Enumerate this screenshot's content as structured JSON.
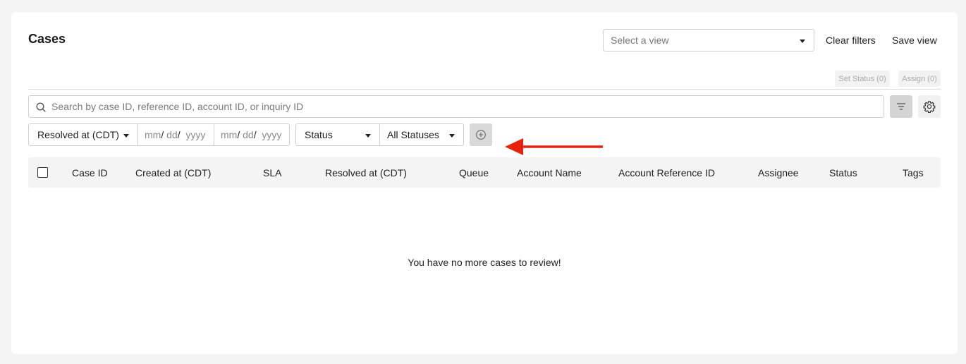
{
  "page": {
    "title": "Cases"
  },
  "header": {
    "view_placeholder": "Select a view",
    "clear_filters": "Clear filters",
    "save_view": "Save view"
  },
  "bulk_actions": {
    "set_status": "Set Status (0)",
    "assign": "Assign (0)"
  },
  "search": {
    "placeholder": "Search by case ID, reference ID, account ID, or inquiry ID"
  },
  "filters": {
    "date_field": "Resolved at (CDT)",
    "date_from": {
      "mm": "mm",
      "dd": "dd",
      "yyyy": "yyyy"
    },
    "date_to": {
      "mm": "mm",
      "dd": "dd",
      "yyyy": "yyyy"
    },
    "status_field": "Status",
    "status_value": "All Statuses"
  },
  "table": {
    "columns": [
      "Case ID",
      "Created at (CDT)",
      "SLA",
      "Resolved at (CDT)",
      "Queue",
      "Account Name",
      "Account Reference ID",
      "Assignee",
      "Status",
      "Tags"
    ],
    "empty_message": "You have no more cases to review!"
  },
  "colors": {
    "annotation_arrow": "#e8230d",
    "filter_button_bg": "#d4d4d4"
  },
  "icons": [
    "search-icon",
    "filter-icon",
    "gear-icon",
    "add-circle-icon",
    "caret-down-icon"
  ]
}
